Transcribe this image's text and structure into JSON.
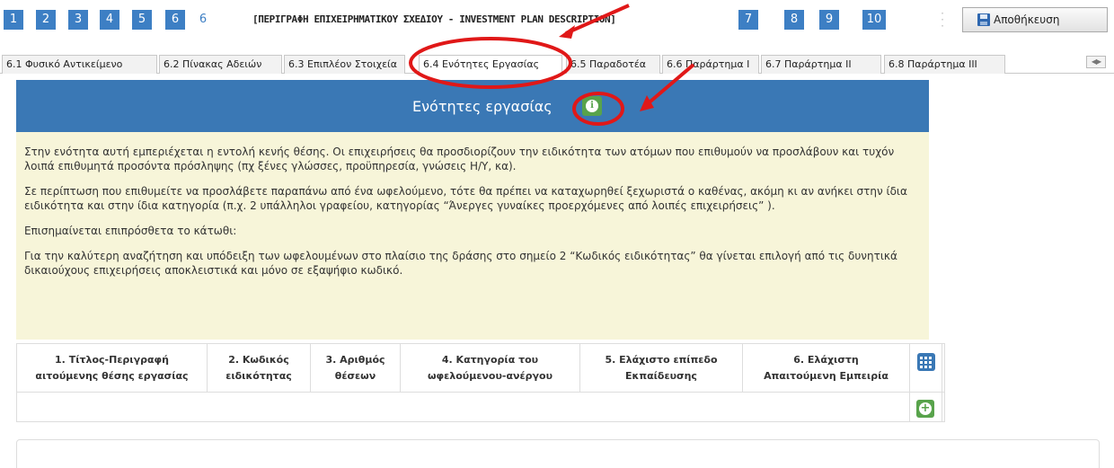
{
  "steps": [
    "1",
    "2",
    "3",
    "4",
    "5",
    "6",
    "7",
    "8",
    "9",
    "10"
  ],
  "step_title": "[ΠΕΡΙΓΡΑΦΗ ΕΠΙΧΕΙΡΗΜΑΤΙΚΟΥ ΣΧΕΔΙΟΥ - INVESTMENT PLAN DESCRIPTION]",
  "save_label": "Αποθήκευση",
  "save_icon": "floppy-disk-icon",
  "tabs": [
    {
      "label": "6.1 Φυσικό Αντικείμενο"
    },
    {
      "label": "6.2 Πίνακας Αδειών"
    },
    {
      "label": "6.3 Επιπλέον Στοιχεία"
    },
    {
      "label": "6.4 Ενότητες Εργασίας"
    },
    {
      "label": "6.5 Παραδοτέα"
    },
    {
      "label": "6.6 Παράρτημα I"
    },
    {
      "label": "6.7 Παράρτημα II"
    },
    {
      "label": "6.8 Παράρτημα III"
    }
  ],
  "active_tab": "6.4 Ενότητες Εργασίας",
  "panel": {
    "title": "Ενότητες εργασίας",
    "info_icon": "info-icon"
  },
  "notice": {
    "p1": "Στην ενότητα αυτή εμπεριέχεται η εντολή κενής θέσης. Οι επιχειρήσεις θα προσδιορίζουν την ειδικότητα των ατόμων που επιθυμούν να προσλάβουν και τυχόν λοιπά επιθυμητά προσόντα πρόσληψης (πχ ξένες γλώσσες, προϋπηρεσία, γνώσεις Η/Υ, κα).",
    "p2": "Σε περίπτωση που επιθυμείτε να προσλάβετε παραπάνω από ένα ωφελούμενο, τότε θα πρέπει να καταχωρηθεί ξεχωριστά ο καθένας, ακόμη κι αν ανήκει στην ίδια ειδικότητα και στην ίδια κατηγορία (π.χ. 2 υπάλληλοι γραφείου, κατηγορίας “Άνεργες γυναίκες προερχόμενες από λοιπές επιχειρήσεις” ).",
    "p3": "Επισημαίνεται επιπρόσθετα το κάτωθι:",
    "p4": "Για την καλύτερη αναζήτηση και υπόδειξη των ωφελουμένων στο πλαίσιο της δράσης στο σημείο 2 “Κωδικός ειδικότητας” θα γίνεται επιλογή από τις δυνητικά δικαιούχους επιχειρήσεις αποκλειστικά και μόνο σε εξαψήφιο κωδικό."
  },
  "table": {
    "columns": [
      {
        "line1": "1. Τίτλος-Περιγραφή",
        "line2": "αιτούμενης θέσης εργασίας"
      },
      {
        "line1": "2. Κωδικός",
        "line2": "ειδικότητας"
      },
      {
        "line1": "3. Αριθμός",
        "line2": "θέσεων"
      },
      {
        "line1": "4. Κατηγορία του",
        "line2": "ωφελούμενου-ανέργου"
      },
      {
        "line1": "5. Ελάχιστο επίπεδο",
        "line2": "Εκπαίδευσης"
      },
      {
        "line1": "6. Ελάχιστη",
        "line2": "Απαιτούμενη Εμπειρία"
      }
    ],
    "column_chooser_icon": "grid-icon",
    "add_icon": "plus-circle-icon",
    "rows": []
  },
  "colors": {
    "step_blue": "#3d7fc4",
    "header_blue": "#3a78b5",
    "notice_yellow": "#f7f5d9",
    "action_green": "#58a34b",
    "annotation_red": "#e01818"
  }
}
